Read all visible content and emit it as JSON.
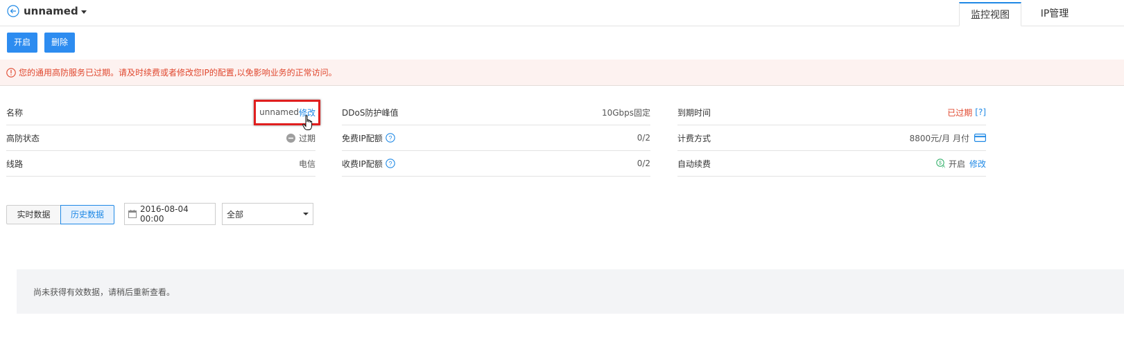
{
  "header": {
    "title": "unnamed",
    "tabs": [
      {
        "label": "监控视图",
        "active": true
      },
      {
        "label": "IP管理",
        "active": false
      }
    ]
  },
  "toolbar": {
    "open_label": "开启",
    "delete_label": "删除"
  },
  "alert": {
    "text": "您的通用高防服务已过期。请及时续费或者修改您IP的配置,以免影响业务的正常访问。"
  },
  "info": {
    "name": {
      "label": "名称",
      "value": "unnamed",
      "action": "修改"
    },
    "protect_status": {
      "label": "高防状态",
      "value": "过期"
    },
    "line": {
      "label": "线路",
      "value": "电信"
    },
    "ddos_peak": {
      "label": "DDoS防护峰值",
      "value": "10Gbps固定"
    },
    "free_ip": {
      "label": "免费IP配额",
      "value": "0/2"
    },
    "paid_ip": {
      "label": "收费IP配额",
      "value": "0/2"
    },
    "expire": {
      "label": "到期时间",
      "value": "已过期",
      "help": "[?]"
    },
    "billing": {
      "label": "计费方式",
      "value": "8800元/月 月付"
    },
    "auto_renew": {
      "label": "自动续费",
      "value": "开启",
      "action": "修改"
    }
  },
  "filters": {
    "realtime_label": "实时数据",
    "history_label": "历史数据",
    "date_value": "2016-08-04 00:00",
    "select_value": "全部"
  },
  "empty_message": "尚未获得有效数据，请稍后重新查看。",
  "colors": {
    "accent": "#1e88e5",
    "button": "#2d8cf0",
    "alert_text": "#e0472e",
    "alert_bg": "#fdf2f0"
  }
}
